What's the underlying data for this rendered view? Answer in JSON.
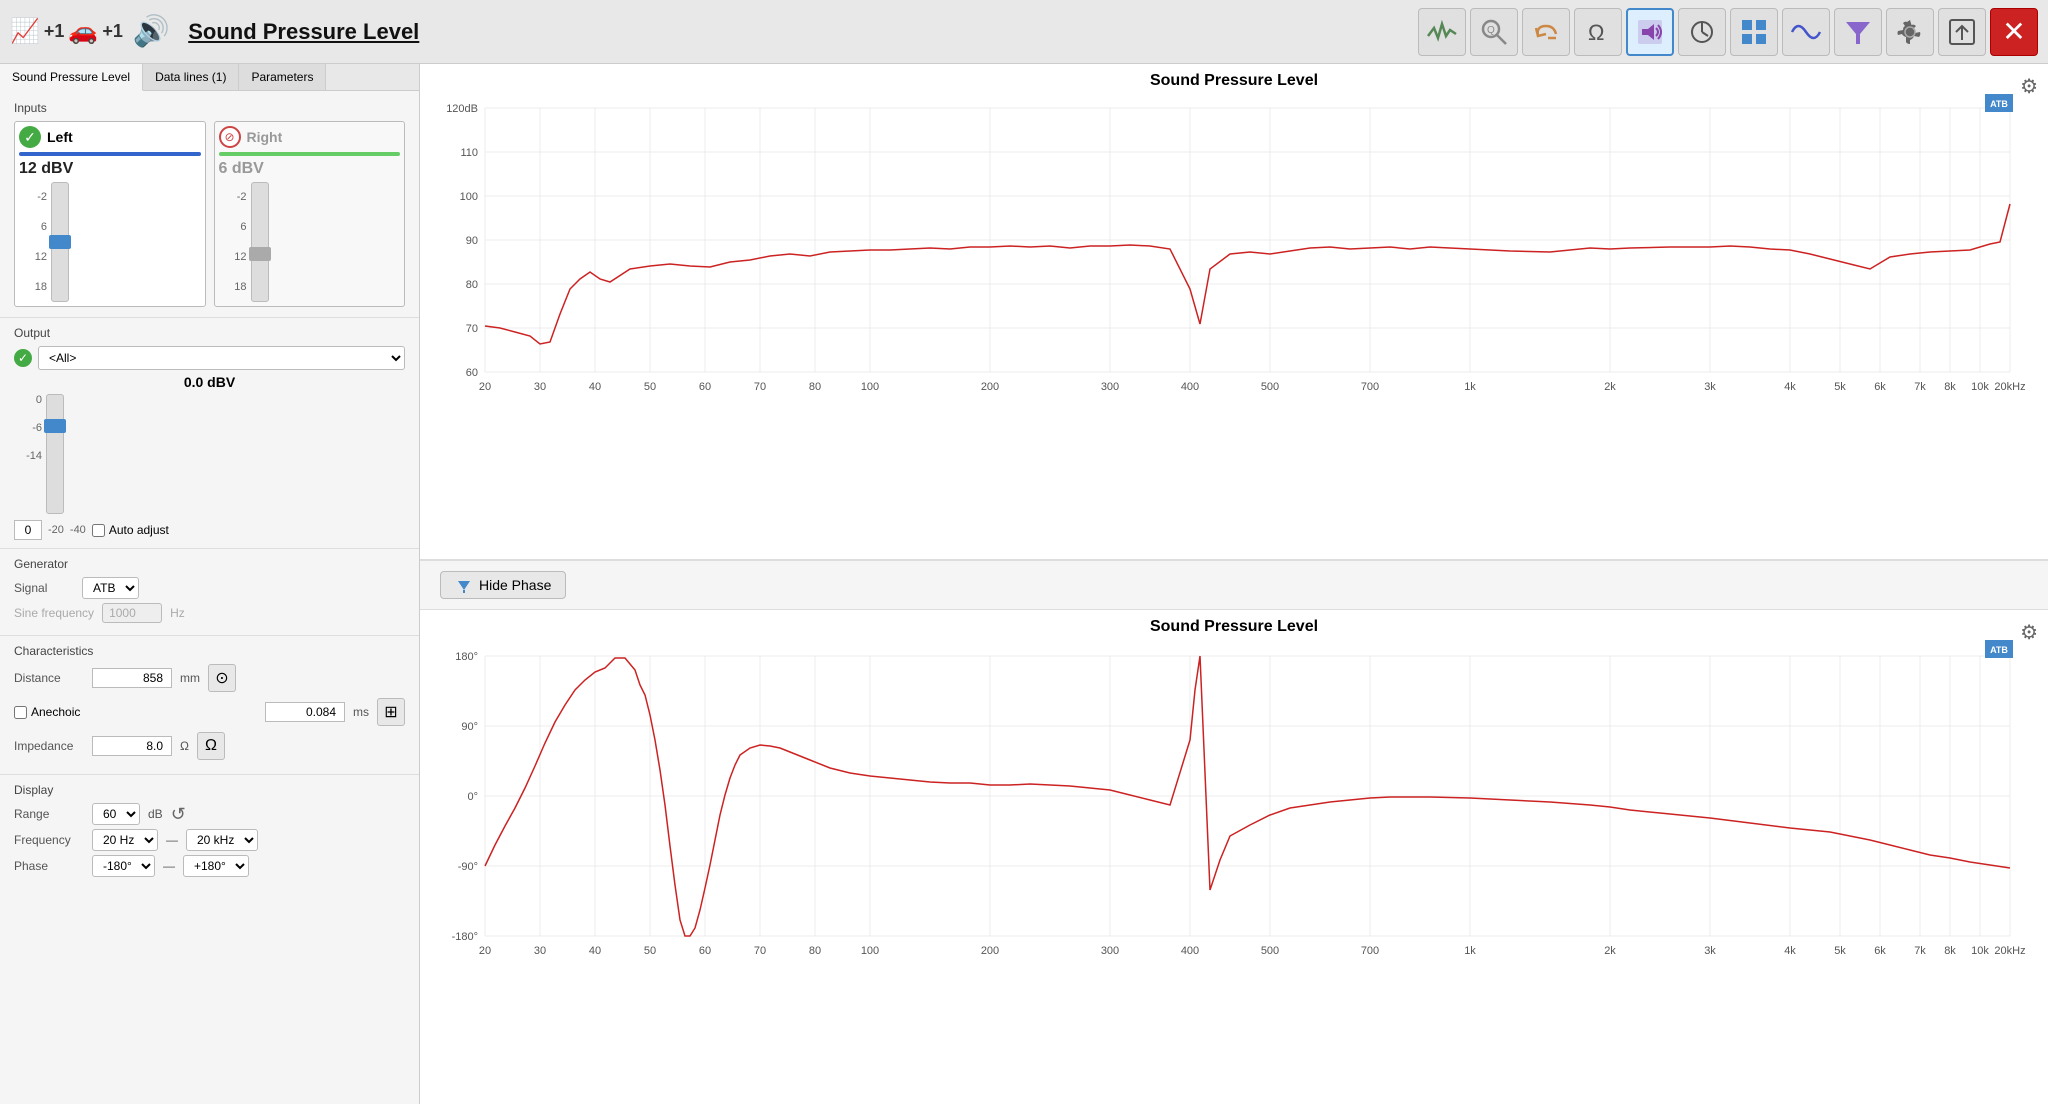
{
  "header": {
    "title": "Sound Pressure Level",
    "badge1": "+1",
    "badge2": "+1",
    "tools": [
      {
        "name": "waveform-icon",
        "symbol": "〜",
        "active": false
      },
      {
        "name": "magnifier-icon",
        "symbol": "🔍",
        "active": false
      },
      {
        "name": "undo-icon",
        "symbol": "↩",
        "active": false
      },
      {
        "name": "omega-icon",
        "symbol": "Ω",
        "active": false
      },
      {
        "name": "speaker-icon",
        "symbol": "🔊",
        "active": true
      },
      {
        "name": "rotation-icon",
        "symbol": "↻",
        "active": false
      },
      {
        "name": "grid-icon",
        "symbol": "⊞",
        "active": false
      },
      {
        "name": "sine-icon",
        "symbol": "∿",
        "active": false
      },
      {
        "name": "filter-icon",
        "symbol": "▽",
        "active": false
      },
      {
        "name": "settings-icon",
        "symbol": "⚙",
        "active": false
      },
      {
        "name": "export-icon",
        "symbol": "⬚",
        "active": false
      }
    ],
    "close_label": "✕"
  },
  "left_panel": {
    "tabs": [
      "Sound Pressure Level",
      "Data lines (1)",
      "Parameters"
    ],
    "inputs_label": "Inputs",
    "left_channel": {
      "name": "Left",
      "active": true,
      "value": "12 dBV",
      "bar_color": "blue"
    },
    "right_channel": {
      "name": "Right",
      "active": false,
      "value": "6 dBV",
      "bar_color": "green"
    },
    "fader_labels": [
      "-2",
      "6",
      "12",
      "18"
    ],
    "output_label": "Output",
    "output_select": "<All>",
    "output_value": "0.0  dBV",
    "output_fader_labels": [
      "0",
      "-6",
      "-14"
    ],
    "output_adjust_box": "0",
    "output_adjust_vals": [
      "-20",
      "-40"
    ],
    "auto_adjust_label": "Auto adjust",
    "generator_label": "Generator",
    "signal_label": "Signal",
    "signal_value": "ATB",
    "sine_freq_label": "Sine frequency",
    "sine_freq_value": "1000",
    "sine_freq_unit": "Hz",
    "characteristics_label": "Characteristics",
    "distance_label": "Distance",
    "distance_value": "858",
    "distance_unit": "mm",
    "anechoic_label": "Anechoic",
    "anechoic_value": "0.084",
    "anechoic_unit": "ms",
    "impedance_label": "Impedance",
    "impedance_value": "8.0",
    "impedance_unit": "Ω",
    "display_label": "Display",
    "range_label": "Range",
    "range_value": "60",
    "range_unit": "dB",
    "freq_label": "Frequency",
    "freq_from": "20 Hz",
    "freq_to": "20 kHz",
    "freq_sep": "—",
    "phase_label": "Phase",
    "phase_from": "-180°",
    "phase_to": "+180°",
    "phase_sep": "—"
  },
  "chart_top": {
    "title": "Sound Pressure Level",
    "y_labels": [
      "120dB",
      "110",
      "100",
      "90",
      "80",
      "70",
      "60"
    ],
    "x_labels": [
      "20",
      "30",
      "40",
      "50",
      "60",
      "70",
      "80",
      "100",
      "200",
      "300",
      "400",
      "500",
      "700",
      "1k",
      "2k",
      "3k",
      "4k",
      "5k",
      "6k",
      "7k",
      "8k",
      "10k",
      "20kHz"
    ]
  },
  "hide_phase_btn": "Hide Phase",
  "chart_bottom": {
    "title": "Sound Pressure Level",
    "y_labels": [
      "180°",
      "90°",
      "0°",
      "-90°",
      "-180°"
    ],
    "x_labels": [
      "20",
      "30",
      "40",
      "50",
      "60",
      "70",
      "80",
      "100",
      "200",
      "300",
      "400",
      "500",
      "700",
      "1k",
      "2k",
      "3k",
      "4k",
      "5k",
      "6k",
      "7k",
      "8k",
      "10k",
      "20kHz"
    ]
  }
}
